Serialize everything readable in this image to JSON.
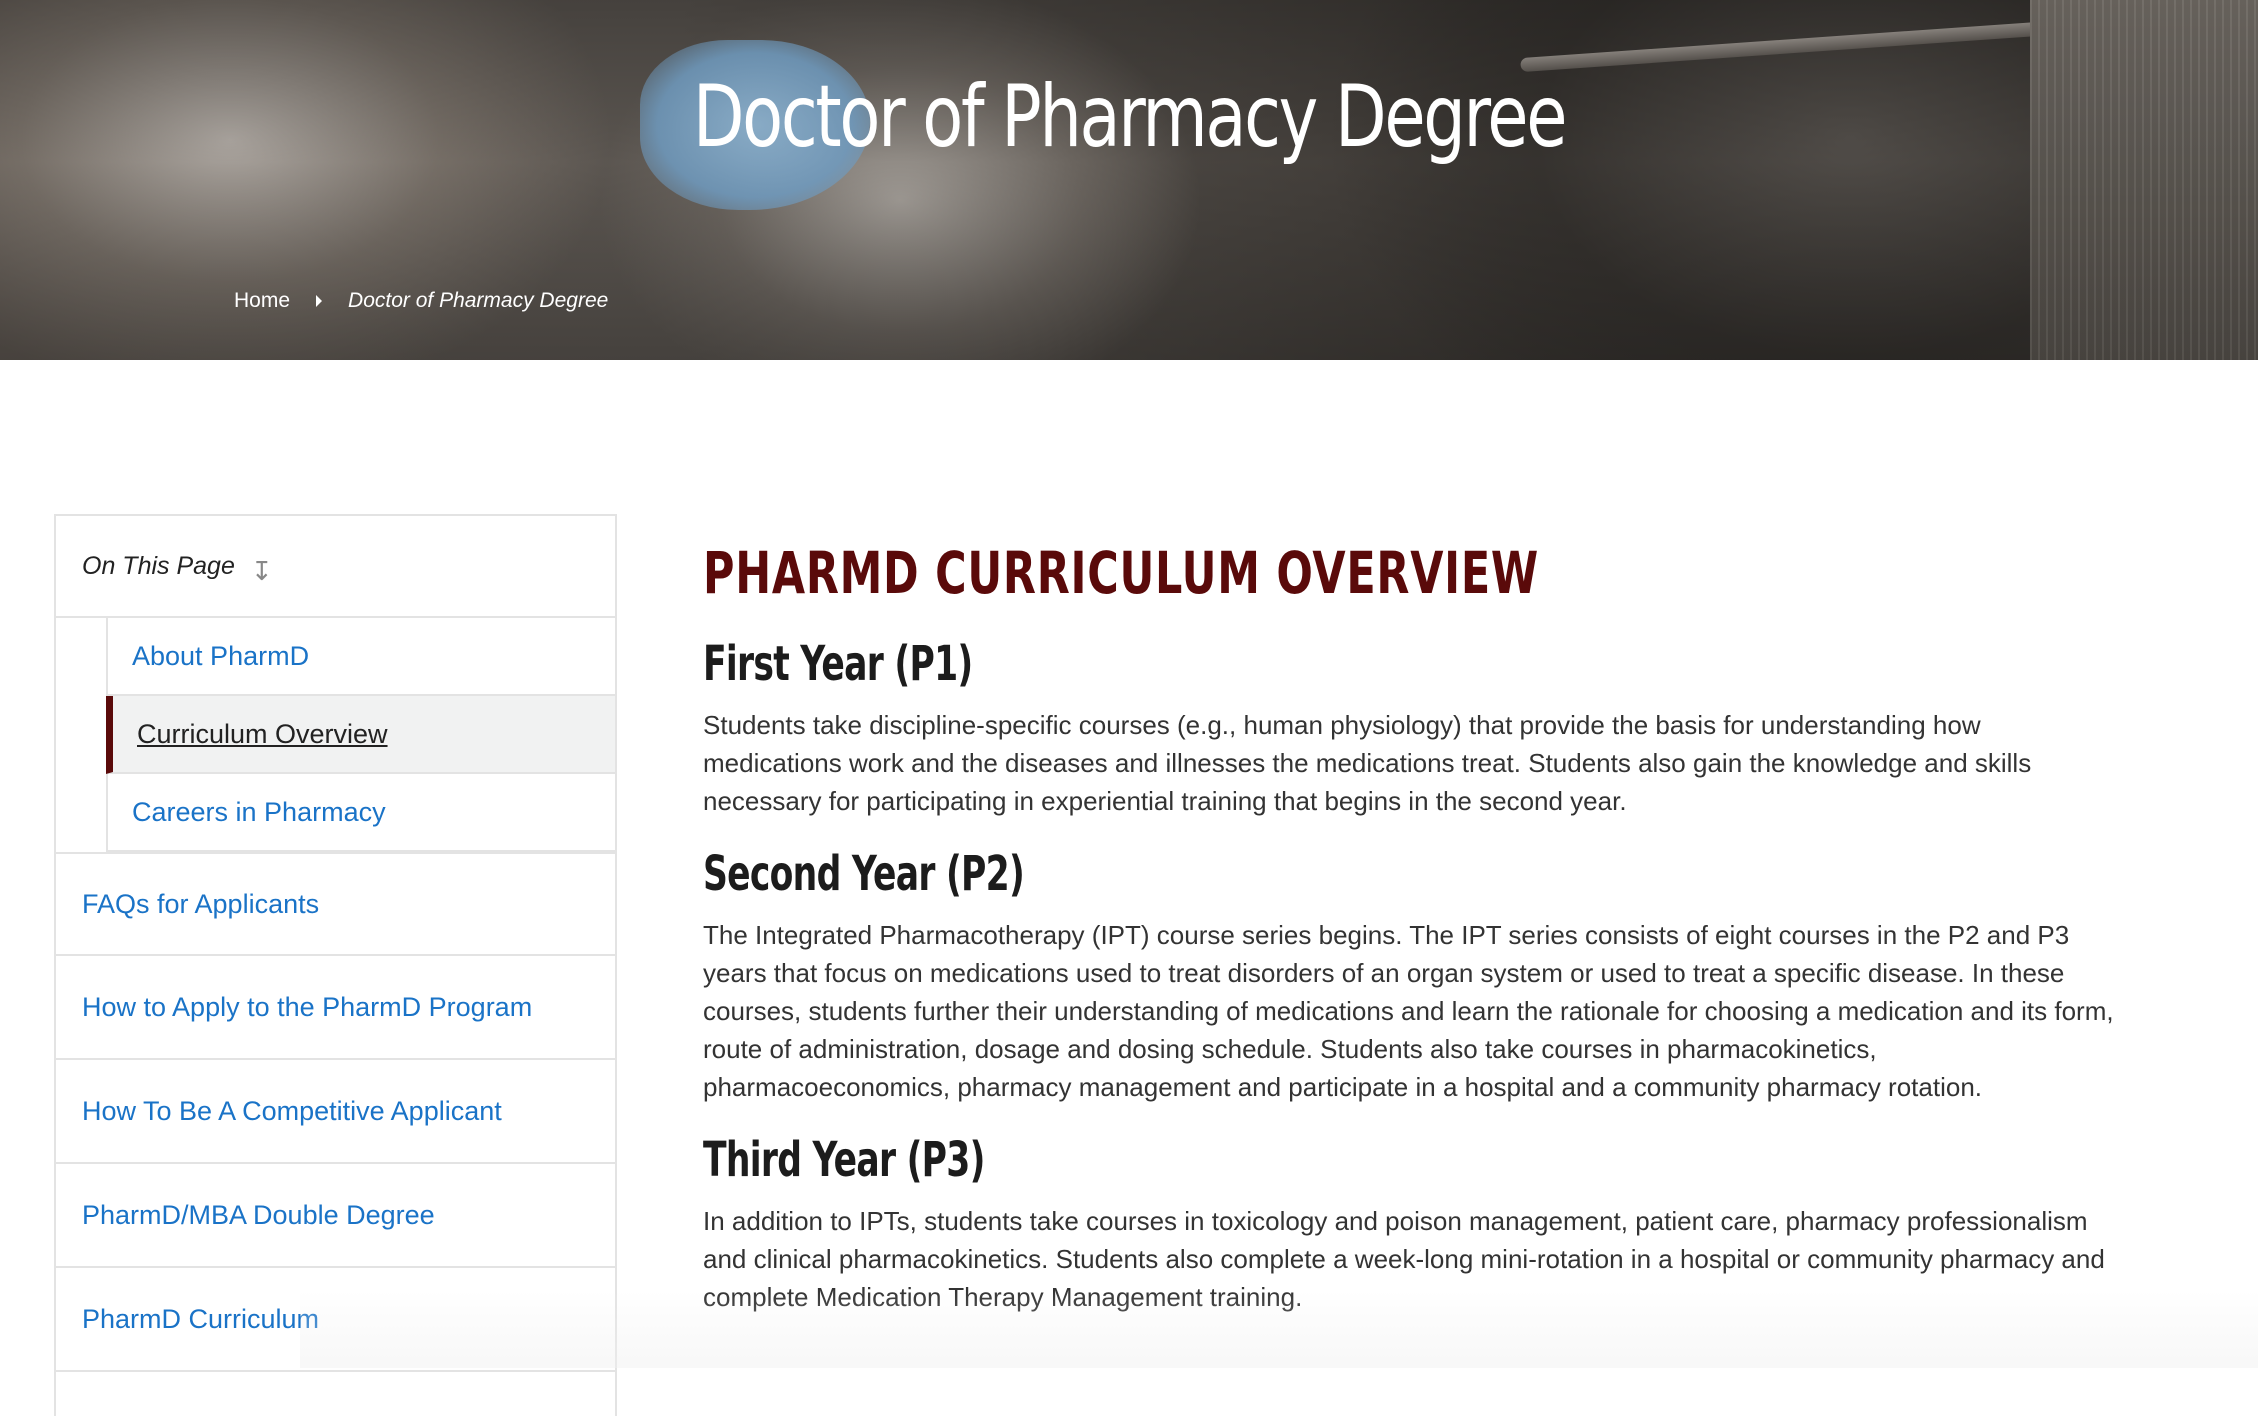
{
  "hero": {
    "title": "Doctor of Pharmacy Degree",
    "breadcrumb": {
      "home": "Home",
      "current": "Doctor of Pharmacy Degree"
    }
  },
  "sidebar": {
    "heading": "On This Page",
    "heading_icon": "arrow-down-icon",
    "sub_items": [
      {
        "label": "About PharmD",
        "active": false
      },
      {
        "label": "Curriculum Overview",
        "active": true
      },
      {
        "label": "Careers in Pharmacy",
        "active": false
      }
    ],
    "items": [
      {
        "label": "FAQs for Applicants"
      },
      {
        "label": "How to Apply to the PharmD Program"
      },
      {
        "label": "How To Be A Competitive Applicant"
      },
      {
        "label": "PharmD/MBA Double Degree"
      },
      {
        "label": "PharmD Curriculum"
      }
    ]
  },
  "main": {
    "section_title": "PHARMD CURRICULUM OVERVIEW",
    "years": [
      {
        "title": "First Year (P1)",
        "text": "Students take discipline-specific courses (e.g., human physiology) that provide the basis for understanding how medications work and the diseases and illnesses the medications treat. Students also gain the knowledge and skills necessary for participating in experiential training that begins in the second year."
      },
      {
        "title": "Second Year (P2)",
        "text": "The Integrated Pharmacotherapy (IPT) course series begins. The IPT series consists of eight courses in the P2 and P3 years that focus on medications used to treat disorders of an organ system or used to treat a specific disease. In these courses, students further their understanding of medications and learn the rationale for choosing a medication and its form, route of administration, dosage and dosing schedule. Students also take courses in pharmacokinetics, pharmacoeconomics, pharmacy management and participate in a hospital and a community pharmacy rotation."
      },
      {
        "title": "Third Year (P3)",
        "text": "In addition to IPTs, students take courses in toxicology and poison management, patient care, pharmacy professionalism and clinical pharmacokinetics. Students also complete a week-long mini-rotation in a hospital or community pharmacy and complete Medication Therapy Management training."
      }
    ]
  },
  "colors": {
    "maroon": "#5a0a0a",
    "link": "#1a73c7",
    "border": "#e3e3e3",
    "active_bg": "#f1f2f2"
  }
}
